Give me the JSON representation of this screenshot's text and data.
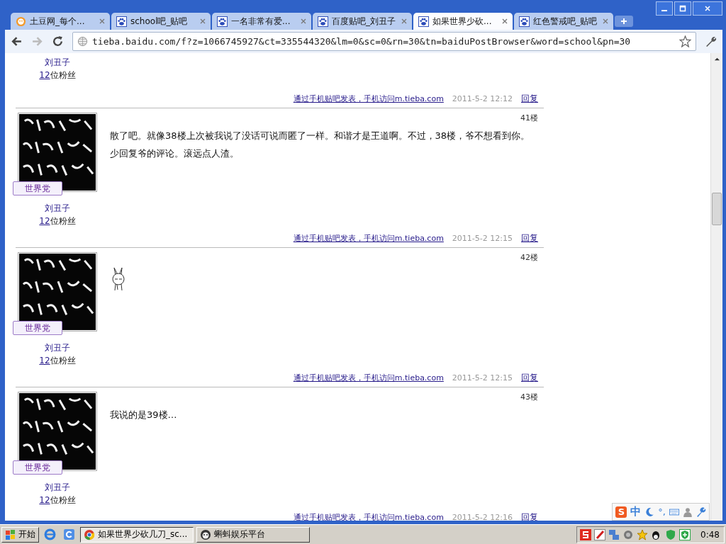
{
  "browser": {
    "tabs": [
      {
        "title": "土豆网_每个...",
        "selected": false
      },
      {
        "title": "school吧_贴吧",
        "selected": false
      },
      {
        "title": "一名非常有爱...",
        "selected": false
      },
      {
        "title": "百度贴吧_刘丑子",
        "selected": false
      },
      {
        "title": "如果世界少砍...",
        "selected": true
      },
      {
        "title": "红色警戒吧_贴吧",
        "selected": false
      }
    ],
    "address": "tieba.baidu.com/f?z=1066745927&ct=335544320&lm=0&sc=0&rn=30&tn=baiduPostBrowser&word=school&pn=30"
  },
  "posts": [
    {
      "author": "刘丑子",
      "fans_count": "12",
      "fans_label": "位粉丝",
      "source": "通过手机贴吧发表，手机访问m.tieba.com",
      "time": "2011-5-2 12:12",
      "reply": "回复"
    },
    {
      "badge": "世界党",
      "author": "刘丑子",
      "fans_count": "12",
      "fans_label": "位粉丝",
      "floor": "41楼",
      "kind": "text",
      "content": "散了吧。就像38楼上次被我说了没话可说而匿了一样。和谐才是王道啊。不过，38楼，爷不想看到你。少回复爷的评论。滚远点人渣。",
      "source": "通过手机贴吧发表，手机访问m.tieba.com",
      "time": "2011-5-2 12:15",
      "reply": "回复"
    },
    {
      "badge": "世界党",
      "author": "刘丑子",
      "fans_count": "12",
      "fans_label": "位粉丝",
      "floor": "42楼",
      "kind": "sticker",
      "source": "通过手机贴吧发表，手机访问m.tieba.com",
      "time": "2011-5-2 12:15",
      "reply": "回复"
    },
    {
      "badge": "世界党",
      "author": "刘丑子",
      "fans_count": "12",
      "fans_label": "位粉丝",
      "floor": "43楼",
      "kind": "text",
      "content": "我说的是39楼…",
      "source": "通过手机贴吧发表，手机访问m.tieba.com",
      "time": "2011-5-2 12:16",
      "reply": "回复"
    }
  ],
  "ime": {
    "logo": "S",
    "mode": "中",
    "punctuation": "°,"
  },
  "taskbar": {
    "start": "开始",
    "tasks": [
      {
        "title": "如果世界少砍几刀_sc...",
        "selected": true
      },
      {
        "title": "蝌蚪娱乐平台",
        "selected": false
      }
    ],
    "clock": "0:48"
  }
}
